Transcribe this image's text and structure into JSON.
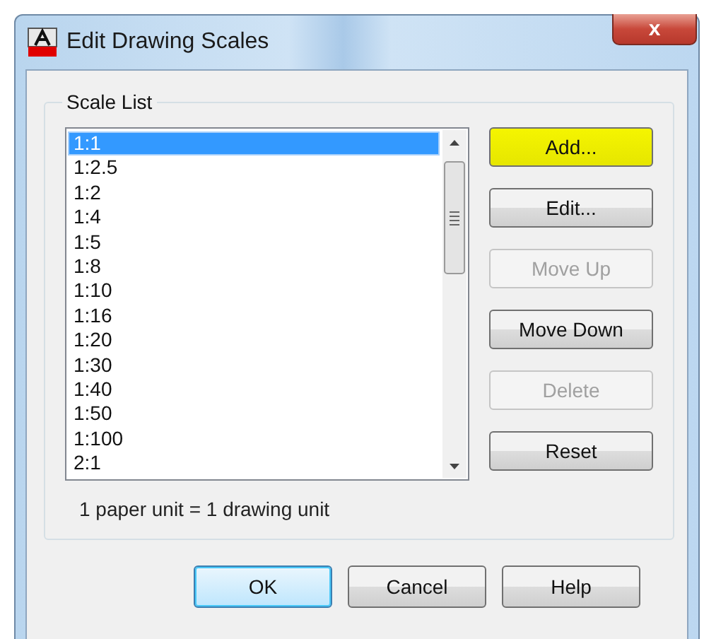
{
  "window": {
    "title": "Edit Drawing Scales",
    "close": "x"
  },
  "scale_list": {
    "title": "Scale List",
    "items": [
      {
        "label": "1:1",
        "selected": true
      },
      {
        "label": "1:2.5",
        "selected": false
      },
      {
        "label": "1:2",
        "selected": false
      },
      {
        "label": "1:4",
        "selected": false
      },
      {
        "label": "1:5",
        "selected": false
      },
      {
        "label": "1:8",
        "selected": false
      },
      {
        "label": "1:10",
        "selected": false
      },
      {
        "label": "1:16",
        "selected": false
      },
      {
        "label": "1:20",
        "selected": false
      },
      {
        "label": "1:30",
        "selected": false
      },
      {
        "label": "1:40",
        "selected": false
      },
      {
        "label": "1:50",
        "selected": false
      },
      {
        "label": "1:100",
        "selected": false
      },
      {
        "label": "2:1",
        "selected": false
      }
    ],
    "note": "1 paper unit = 1 drawing unit"
  },
  "side_buttons": [
    {
      "label": "Add...",
      "disabled": false,
      "highlighted": true
    },
    {
      "label": "Edit...",
      "disabled": false,
      "highlighted": false
    },
    {
      "label": "Move Up",
      "disabled": true,
      "highlighted": false
    },
    {
      "label": "Move Down",
      "disabled": false,
      "highlighted": false
    },
    {
      "label": "Delete",
      "disabled": true,
      "highlighted": false
    },
    {
      "label": "Reset",
      "disabled": false,
      "highlighted": false
    }
  ],
  "footer_buttons": [
    {
      "label": "OK",
      "default": true
    },
    {
      "label": "Cancel",
      "default": false
    },
    {
      "label": "Help",
      "default": false
    }
  ]
}
